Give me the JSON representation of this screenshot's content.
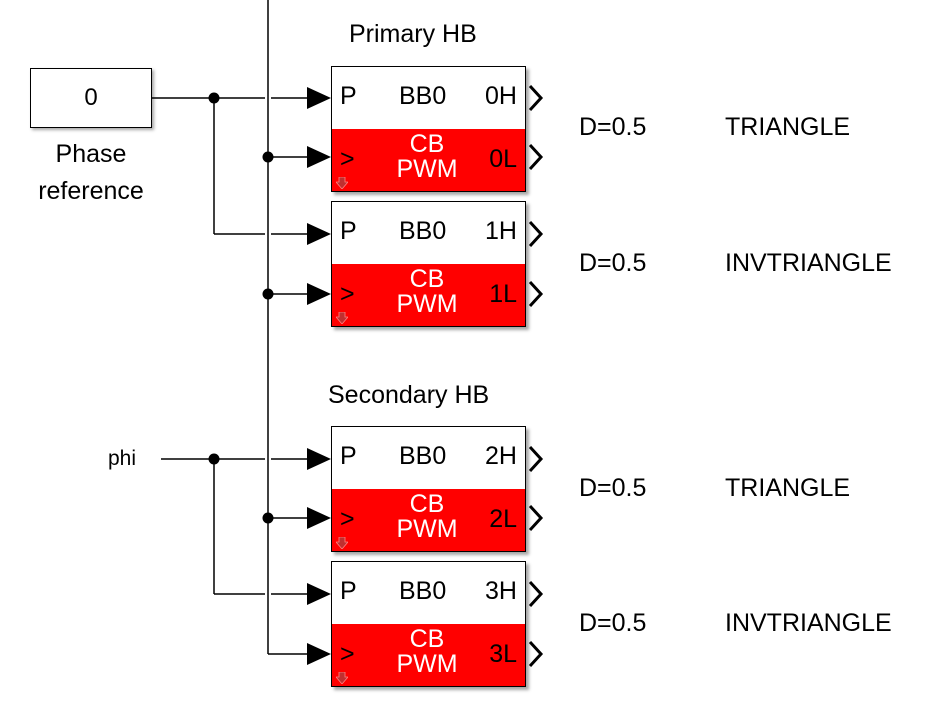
{
  "diagram": {
    "constant_block": {
      "value": "0",
      "label_line1": "Phase",
      "label_line2": "reference"
    },
    "phi_label": "phi",
    "groups": [
      {
        "title": "Primary HB"
      },
      {
        "title": "Secondary HB"
      }
    ],
    "pwm_blocks": [
      {
        "in_p": "P",
        "in_clk": ">",
        "board": "BB0",
        "out_h": "0H",
        "out_l": "0L",
        "type_line1": "CB",
        "type_line2": "PWM",
        "duty": "D=0.5",
        "carrier": "TRIANGLE"
      },
      {
        "in_p": "P",
        "in_clk": ">",
        "board": "BB0",
        "out_h": "1H",
        "out_l": "1L",
        "type_line1": "CB",
        "type_line2": "PWM",
        "duty": "D=0.5",
        "carrier": "INVTRIANGLE"
      },
      {
        "in_p": "P",
        "in_clk": ">",
        "board": "BB0",
        "out_h": "2H",
        "out_l": "2L",
        "type_line1": "CB",
        "type_line2": "PWM",
        "duty": "D=0.5",
        "carrier": "TRIANGLE"
      },
      {
        "in_p": "P",
        "in_clk": ">",
        "board": "BB0",
        "out_h": "3H",
        "out_l": "3L",
        "type_line1": "CB",
        "type_line2": "PWM",
        "duty": "D=0.5",
        "carrier": "INVTRIANGLE"
      }
    ],
    "colors": {
      "pwm_fill": "#ff0000",
      "wire": "#000000",
      "background": "#ffffff"
    }
  }
}
